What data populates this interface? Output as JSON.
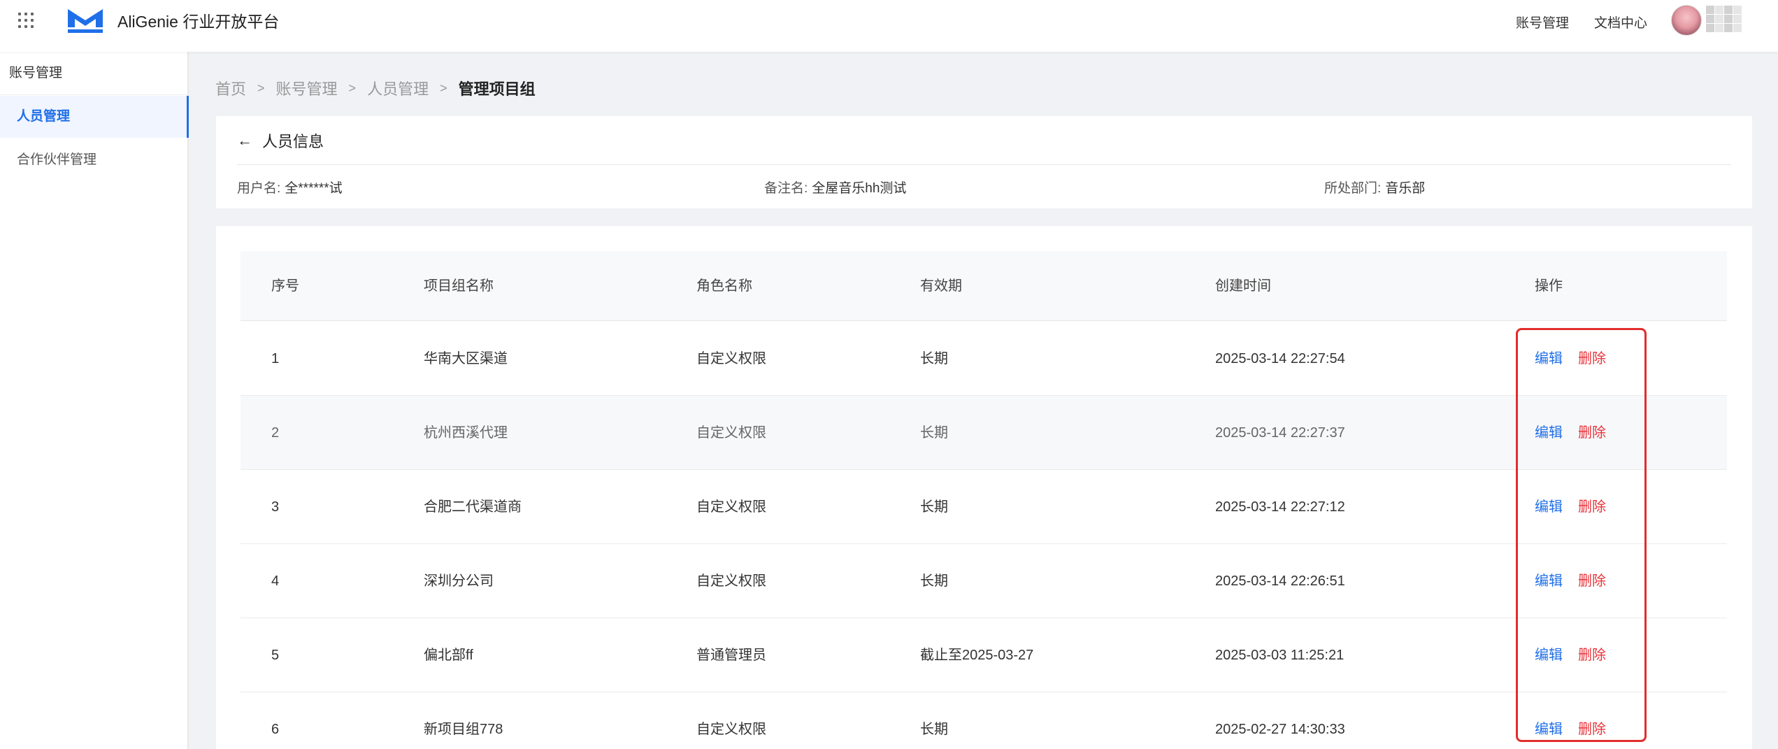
{
  "header": {
    "brand": "AliGenie 行业开放平台",
    "links": [
      "账号管理",
      "文档中心"
    ]
  },
  "sidebar": {
    "group_label": "账号管理",
    "items": [
      {
        "label": "人员管理",
        "active": true
      },
      {
        "label": "合作伙伴管理",
        "active": false
      }
    ]
  },
  "breadcrumb": {
    "items": [
      "首页",
      "账号管理",
      "人员管理",
      "管理项目组"
    ],
    "separator": ">"
  },
  "info": {
    "title": "人员信息",
    "username_label": "用户名:",
    "username": "全******试",
    "remark_label": "备注名:",
    "remark": "全屋音乐hh测试",
    "dept_label": "所处部门:",
    "dept": "音乐部"
  },
  "table": {
    "headers": [
      "序号",
      "项目组名称",
      "角色名称",
      "有效期",
      "创建时间",
      "操作"
    ],
    "edit_label": "编辑",
    "delete_label": "删除",
    "rows": [
      {
        "index": "1",
        "name": "华南大区渠道",
        "role": "自定义权限",
        "validity": "长期",
        "created": "2025-03-14 22:27:54"
      },
      {
        "index": "2",
        "name": "杭州西溪代理",
        "role": "自定义权限",
        "validity": "长期",
        "created": "2025-03-14 22:27:37"
      },
      {
        "index": "3",
        "name": "合肥二代渠道商",
        "role": "自定义权限",
        "validity": "长期",
        "created": "2025-03-14 22:27:12"
      },
      {
        "index": "4",
        "name": "深圳分公司",
        "role": "自定义权限",
        "validity": "长期",
        "created": "2025-03-14 22:26:51"
      },
      {
        "index": "5",
        "name": "偏北部ff",
        "role": "普通管理员",
        "validity": "截止至2025-03-27",
        "created": "2025-03-03 11:25:21"
      },
      {
        "index": "6",
        "name": "新项目组778",
        "role": "自定义权限",
        "validity": "长期",
        "created": "2025-02-27 14:30:33"
      }
    ]
  },
  "colors": {
    "accent": "#1f6fe8",
    "danger": "#e8333a",
    "highlight_border": "#e22d2d"
  }
}
